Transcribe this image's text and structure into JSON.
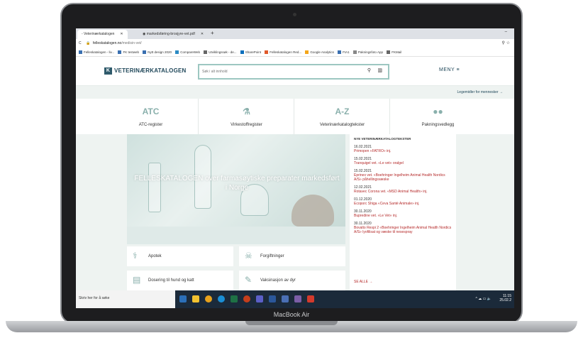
{
  "device": {
    "brand": "MacBook Air"
  },
  "browser": {
    "tabs": [
      {
        "label": "- Veterinærkatalogen",
        "active": true
      },
      {
        "label": "markedsføring-brosjyre-vet.pdf",
        "active": false
      }
    ],
    "url_host": "felleskatalogen.no",
    "url_path": "/medisin-vet/",
    "bookmarks": [
      "Felleskatalogen - liv...",
      "FK testweb",
      "Nytt design 2020",
      "CompareWeb",
      "Utviklingssøk - de...",
      "SharePoint",
      "Felleskatalogen Red...",
      "Google Analytics",
      "FIA1",
      "Pakningsfoto App",
      "FKMail"
    ]
  },
  "site": {
    "logo_text": "VETERINÆRKATALOGEN",
    "search_placeholder": "Søk i alt innhold",
    "menu_label": "MENY ≡",
    "human_link": "Legemidler for mennesker →",
    "categories": [
      {
        "icon_text": "ATC",
        "label": "ATC-register"
      },
      {
        "icon_text": "⚗",
        "label": "Virkestoffregister"
      },
      {
        "icon_text": "A-Z",
        "label": "Veterinærkatalogtekster"
      },
      {
        "icon_text": "●●",
        "label": "Pakningsvedlegg"
      }
    ],
    "hero_title": "FELLESKATALOGEN over farmasøytiske preparater markedsført i Norge",
    "news_heading": "NYE VETERINÆRKATALOGTEKSTER",
    "news": [
      {
        "date": "16.02.2021",
        "text": "Primopen «FATRO» inj."
      },
      {
        "date": "15.02.2021",
        "text": "Tranquigel vet. «Le vet» oralgel"
      },
      {
        "date": "15.02.2021",
        "text": "Eprinex vet. «Boehringer Ingelheim Animal Health Nordics A/S» påhellingsvæske"
      },
      {
        "date": "12.02.2021",
        "text": "Rotavec Corona vet. «MSD Animal Health» inj."
      },
      {
        "date": "01.12.2020",
        "text": "Ecoporc Shiga «Ceva Santé Animale» inj."
      },
      {
        "date": "30.11.2020",
        "text": "Bupredine vet. «Le Vet» inj."
      },
      {
        "date": "30.11.2020",
        "text": "Bovalto Respi 2 «Boehringer Ingelheim Animal Health Nordics A/S» lyofilisat og væske til nesespray"
      }
    ],
    "news_more": "SE ALLE →",
    "boxes": [
      {
        "label": "Apotek"
      },
      {
        "label": "Forgiftninger"
      },
      {
        "label": "Dosering til hund og katt"
      },
      {
        "label": "Vaksinasjon av dyr"
      }
    ]
  },
  "taskbar": {
    "search_text": "Skriv her for å søke",
    "time": "11:15",
    "date": "25.02.2"
  }
}
